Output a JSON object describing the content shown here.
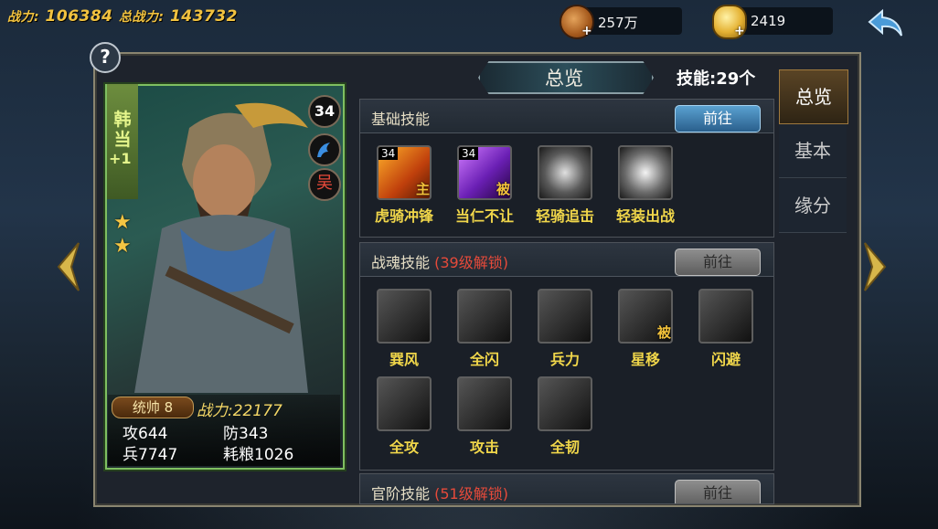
{
  "top": {
    "combat_power_label": "战力:",
    "combat_power": "106384",
    "total_power_label": "总战力:",
    "total_power": "143732",
    "copper": "257万",
    "gold": "2419",
    "plus": "+"
  },
  "help": "?",
  "hero": {
    "name": "韩当",
    "plus_level": "+1",
    "level": "34",
    "kingdom": "吴",
    "stars": [
      "★",
      "★"
    ],
    "rank": "统帅 8",
    "power_label": "战力:",
    "power": "22177",
    "stats": {
      "attack_label": "攻",
      "attack": "644",
      "defense_label": "防",
      "defense": "343",
      "troops_label": "兵",
      "troops": "7747",
      "grain_label": "耗粮",
      "grain": "1026"
    }
  },
  "panel": {
    "title": "总览",
    "skill_count": "技能:29个"
  },
  "sections": {
    "basic": {
      "title": "基础技能",
      "button": "前往",
      "skills": [
        {
          "name": "虎骑冲锋",
          "level": "34",
          "tag": "主"
        },
        {
          "name": "当仁不让",
          "level": "34",
          "tag": "被"
        },
        {
          "name": "轻骑追击",
          "level": "",
          "tag": ""
        },
        {
          "name": "轻装出战",
          "level": "",
          "tag": ""
        }
      ]
    },
    "soul": {
      "title": "战魂技能",
      "lock": "(39级解锁)",
      "button": "前往",
      "skills": [
        {
          "name": "巽风",
          "tag": ""
        },
        {
          "name": "全闪",
          "tag": ""
        },
        {
          "name": "兵力",
          "tag": ""
        },
        {
          "name": "星移",
          "tag": "被"
        },
        {
          "name": "闪避",
          "tag": ""
        },
        {
          "name": "全攻",
          "tag": ""
        },
        {
          "name": "攻击",
          "tag": ""
        },
        {
          "name": "全韧",
          "tag": ""
        }
      ]
    },
    "rank": {
      "title": "官阶技能",
      "lock": "(51级解锁)",
      "button": "前往"
    }
  },
  "tabs": [
    "总览",
    "基本",
    "缘分"
  ],
  "colors": {
    "accent_gold": "#f0d64a",
    "lock_red": "#e64a3a",
    "button_blue": "#3a7fb3"
  },
  "icons": [
    "back-arrow-icon",
    "help-icon",
    "copper-coin-icon",
    "gold-ingot-icon",
    "left-arrow-icon",
    "right-arrow-icon",
    "star-icon",
    "horse-class-icon"
  ]
}
